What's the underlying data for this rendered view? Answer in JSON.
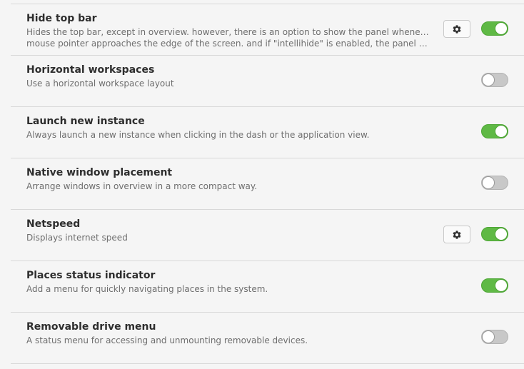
{
  "extensions": [
    {
      "title": "Hide top bar",
      "description_lines": [
        "Hides the top bar, except in overview. however, there is an option to show the panel whenever the",
        "mouse pointer approaches the edge of the screen. and if \"intellihide\" is enabled, the panel only hid…"
      ],
      "has_settings": true,
      "enabled": true
    },
    {
      "title": "Horizontal workspaces",
      "description_lines": [
        "Use a horizontal workspace layout"
      ],
      "has_settings": false,
      "enabled": false
    },
    {
      "title": "Launch new instance",
      "description_lines": [
        "Always launch a new instance when clicking in the dash or the application view."
      ],
      "has_settings": false,
      "enabled": true
    },
    {
      "title": "Native window placement",
      "description_lines": [
        "Arrange windows in overview in a more compact way."
      ],
      "has_settings": false,
      "enabled": false
    },
    {
      "title": "Netspeed",
      "description_lines": [
        "Displays internet speed"
      ],
      "has_settings": true,
      "enabled": true
    },
    {
      "title": "Places status indicator",
      "description_lines": [
        "Add a menu for quickly navigating places in the system."
      ],
      "has_settings": false,
      "enabled": true
    },
    {
      "title": "Removable drive menu",
      "description_lines": [
        "A status menu for accessing and unmounting removable devices."
      ],
      "has_settings": false,
      "enabled": false
    }
  ],
  "icons": {
    "settings": "gear-icon"
  },
  "colors": {
    "toggle_on": "#5fb945",
    "toggle_off": "#c8c8c8"
  }
}
